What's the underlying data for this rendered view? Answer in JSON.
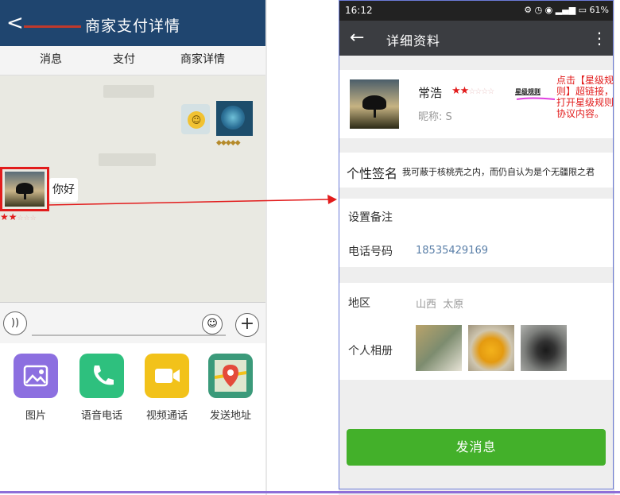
{
  "left": {
    "header": {
      "back": "<",
      "title": "商家支付详情"
    },
    "tabs": [
      "消息",
      "支付",
      "商家详情"
    ],
    "messages": [
      {
        "sender": "other",
        "text": "你好"
      }
    ],
    "tools": [
      {
        "label": "图片",
        "icon": "image-icon",
        "color": "#8c6fe0"
      },
      {
        "label": "语音电话",
        "icon": "phone-icon",
        "color": "#2ec07e"
      },
      {
        "label": "视频通话",
        "icon": "video-icon",
        "color": "#f2c21a"
      },
      {
        "label": "发送地址",
        "icon": "map-icon",
        "color": "#3b9a7a"
      }
    ],
    "input": {
      "voice": "))",
      "plus": "+"
    }
  },
  "right": {
    "status": {
      "time": "16:12",
      "battery": "61%"
    },
    "appbar": {
      "back": "←",
      "title": "详细资料",
      "menu": "⋮"
    },
    "profile": {
      "name": "常浩",
      "rule_link": "星级规则",
      "nickname": "昵称: S"
    },
    "signature": {
      "label": "个性签名",
      "text": "我可蔽于核桃壳之内，而仍自认为是个无疆限之君"
    },
    "remark": "设置备注",
    "phone": {
      "label": "电话号码",
      "value": "18535429169"
    },
    "region": {
      "label": "地区",
      "value": "山西  太原"
    },
    "album": {
      "label": "个人相册"
    },
    "send_button": "发消息"
  },
  "annotation": {
    "note": "点击【星级规则】超链接，打开星级规则协议内容。"
  },
  "colors": {
    "header": "#1f456f",
    "send": "#43b02a",
    "annotation": "#e21c1c"
  }
}
